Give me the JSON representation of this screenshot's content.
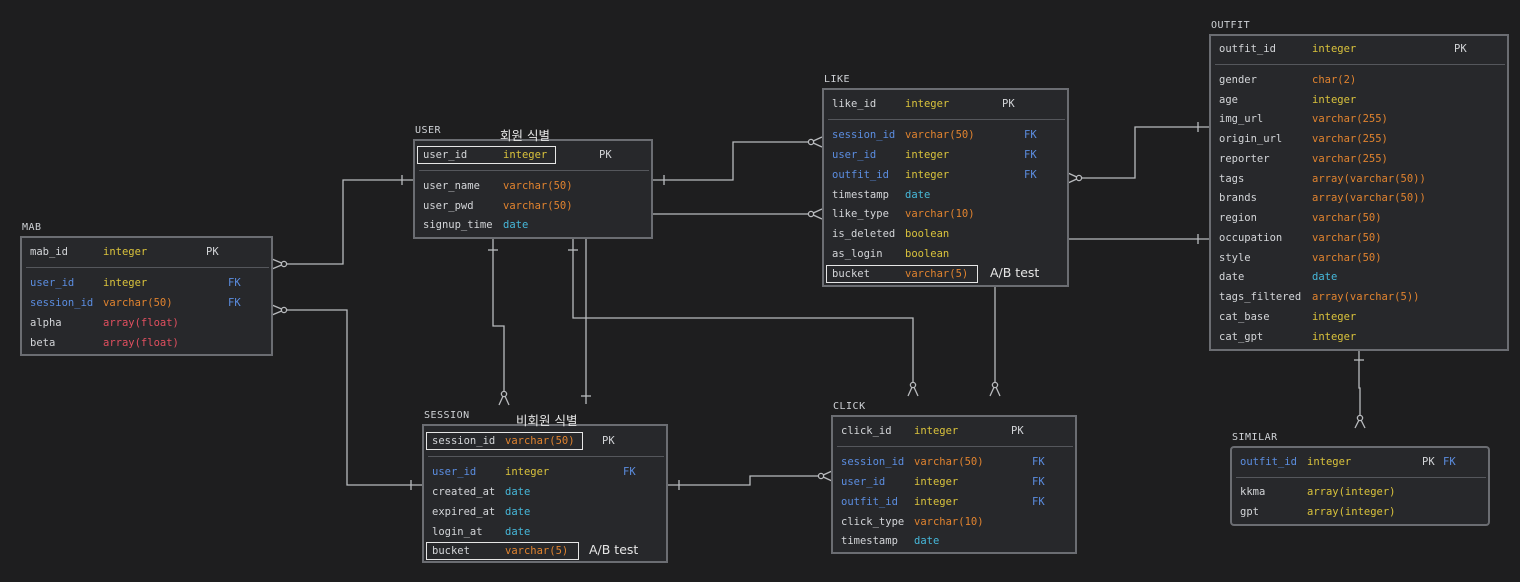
{
  "tables": {
    "mab": {
      "name": "MAB",
      "pk_rows": [
        {
          "col": "mab_id",
          "type": "integer",
          "key": "PK"
        }
      ],
      "rows": [
        {
          "col": "user_id",
          "type": "integer",
          "key": "FK"
        },
        {
          "col": "session_id",
          "type": "varchar(50)",
          "key": "FK"
        },
        {
          "col": "alpha",
          "type": "array(float)",
          "key": ""
        },
        {
          "col": "beta",
          "type": "array(float)",
          "key": ""
        }
      ]
    },
    "user": {
      "name": "USER",
      "pk_rows": [
        {
          "col": "user_id",
          "type": "integer",
          "key": "PK"
        }
      ],
      "rows": [
        {
          "col": "user_name",
          "type": "varchar(50)",
          "key": ""
        },
        {
          "col": "user_pwd",
          "type": "varchar(50)",
          "key": ""
        },
        {
          "col": "signup_time",
          "type": "date",
          "key": ""
        }
      ]
    },
    "like": {
      "name": "LIKE",
      "pk_rows": [
        {
          "col": "like_id",
          "type": "integer",
          "key": "PK"
        }
      ],
      "rows": [
        {
          "col": "session_id",
          "type": "varchar(50)",
          "key": "FK"
        },
        {
          "col": "user_id",
          "type": "integer",
          "key": "FK"
        },
        {
          "col": "outfit_id",
          "type": "integer",
          "key": "FK"
        },
        {
          "col": "timestamp",
          "type": "date",
          "key": ""
        },
        {
          "col": "like_type",
          "type": "varchar(10)",
          "key": ""
        },
        {
          "col": "is_deleted",
          "type": "boolean",
          "key": ""
        },
        {
          "col": "as_login",
          "type": "boolean",
          "key": ""
        },
        {
          "col": "bucket",
          "type": "varchar(5)",
          "key": ""
        }
      ]
    },
    "outfit": {
      "name": "OUTFIT",
      "pk_rows": [
        {
          "col": "outfit_id",
          "type": "integer",
          "key": "PK"
        }
      ],
      "rows": [
        {
          "col": "gender",
          "type": "char(2)",
          "key": ""
        },
        {
          "col": "age",
          "type": "integer",
          "key": ""
        },
        {
          "col": "img_url",
          "type": "varchar(255)",
          "key": ""
        },
        {
          "col": "origin_url",
          "type": "varchar(255)",
          "key": ""
        },
        {
          "col": "reporter",
          "type": "varchar(255)",
          "key": ""
        },
        {
          "col": "tags",
          "type": "array(varchar(50))",
          "key": ""
        },
        {
          "col": "brands",
          "type": "array(varchar(50))",
          "key": ""
        },
        {
          "col": "region",
          "type": "varchar(50)",
          "key": ""
        },
        {
          "col": "occupation",
          "type": "varchar(50)",
          "key": ""
        },
        {
          "col": "style",
          "type": "varchar(50)",
          "key": ""
        },
        {
          "col": "date",
          "type": "date",
          "key": ""
        },
        {
          "col": "tags_filtered",
          "type": "array(varchar(5))",
          "key": ""
        },
        {
          "col": "cat_base",
          "type": "integer",
          "key": ""
        },
        {
          "col": "cat_gpt",
          "type": "integer",
          "key": ""
        }
      ]
    },
    "session": {
      "name": "SESSION",
      "pk_rows": [
        {
          "col": "session_id",
          "type": "varchar(50)",
          "key": "PK"
        }
      ],
      "rows": [
        {
          "col": "user_id",
          "type": "integer",
          "key": "FK"
        },
        {
          "col": "created_at",
          "type": "date",
          "key": ""
        },
        {
          "col": "expired_at",
          "type": "date",
          "key": ""
        },
        {
          "col": "login_at",
          "type": "date",
          "key": ""
        },
        {
          "col": "bucket",
          "type": "varchar(5)",
          "key": ""
        }
      ]
    },
    "click": {
      "name": "CLICK",
      "pk_rows": [
        {
          "col": "click_id",
          "type": "integer",
          "key": "PK"
        }
      ],
      "rows": [
        {
          "col": "session_id",
          "type": "varchar(50)",
          "key": "FK"
        },
        {
          "col": "user_id",
          "type": "integer",
          "key": "FK"
        },
        {
          "col": "outfit_id",
          "type": "integer",
          "key": "FK"
        },
        {
          "col": "click_type",
          "type": "varchar(10)",
          "key": ""
        },
        {
          "col": "timestamp",
          "type": "date",
          "key": ""
        }
      ]
    },
    "similar": {
      "name": "SIMILAR",
      "pk_rows": [
        {
          "col": "outfit_id",
          "type": "integer",
          "key": "PK FK"
        }
      ],
      "rows": [
        {
          "col": "kkma",
          "type": "array(integer)",
          "key": ""
        },
        {
          "col": "gpt",
          "type": "array(integer)",
          "key": ""
        }
      ]
    }
  },
  "notes": {
    "member": "회원 식별",
    "non_member": "비회원 식별",
    "ab_like": "A/B test",
    "ab_session": "A/B test"
  },
  "colors": {
    "background": "#1e1e1f",
    "table_bg": "#27282b",
    "border": "#6b6d72",
    "line": "#b9bbbe",
    "column": "#d3d5d8",
    "fk_column": "#5b8de0",
    "integer": "#d9c23c",
    "varchar": "#e0832f",
    "date": "#46b7d9",
    "array_float": "#e04f5f"
  }
}
